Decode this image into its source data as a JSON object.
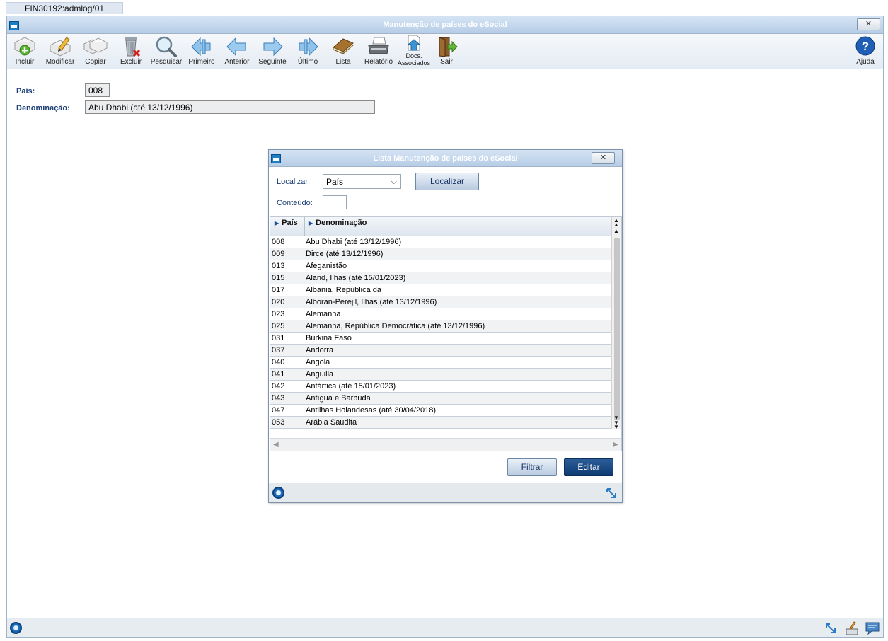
{
  "app": {
    "tab_label": "FIN30192:admlog/01",
    "window_title": "Manutenção de países do eSocial"
  },
  "toolbar": {
    "buttons": [
      {
        "label": "Incluir",
        "icon": "add-doc-icon"
      },
      {
        "label": "Modificar",
        "icon": "edit-doc-icon"
      },
      {
        "label": "Copiar",
        "icon": "copy-doc-icon"
      },
      {
        "label": "Excluir",
        "icon": "trash-icon"
      },
      {
        "label": "Pesquisar",
        "icon": "search-icon"
      },
      {
        "label": "Primeiro",
        "icon": "first-arrow-icon"
      },
      {
        "label": "Anterior",
        "icon": "prev-arrow-icon"
      },
      {
        "label": "Seguinte",
        "icon": "next-arrow-icon"
      },
      {
        "label": "Último",
        "icon": "last-arrow-icon"
      },
      {
        "label": "Lista",
        "icon": "book-icon"
      },
      {
        "label": "Relatório",
        "icon": "printer-icon"
      },
      {
        "label": "Docs. Associados",
        "icon": "upload-doc-icon"
      },
      {
        "label": "Sair",
        "icon": "exit-door-icon"
      }
    ],
    "help_label": "Ajuda",
    "help_icon": "help-icon"
  },
  "form": {
    "pais_label": "País:",
    "pais_value": "008",
    "denominacao_label": "Denominação:",
    "denominacao_value": "Abu Dhabi (até 13/12/1996)"
  },
  "dialog": {
    "title": "Lista Manutenção de países do eSocial",
    "localizar_label": "Localizar:",
    "localizar_selected": "País",
    "localizar_button": "Localizar",
    "conteudo_label": "Conteúdo:",
    "conteudo_value": "",
    "grid": {
      "columns": [
        "País",
        "Denominação"
      ],
      "rows": [
        [
          "008",
          "Abu Dhabi (até 13/12/1996)"
        ],
        [
          "009",
          "Dirce (até 13/12/1996)"
        ],
        [
          "013",
          "Afeganistão"
        ],
        [
          "015",
          "Aland, Ilhas (até 15/01/2023)"
        ],
        [
          "017",
          "Albania, República da"
        ],
        [
          "020",
          "Alboran-Perejil, Ilhas (até 13/12/1996)"
        ],
        [
          "023",
          "Alemanha"
        ],
        [
          "025",
          "Alemanha, República Democrática (até 13/12/1996)"
        ],
        [
          "031",
          "Burkina Faso"
        ],
        [
          "037",
          "Andorra"
        ],
        [
          "040",
          "Angola"
        ],
        [
          "041",
          "Anguilla"
        ],
        [
          "042",
          "Antártica (até 15/01/2023)"
        ],
        [
          "043",
          "Antígua e Barbuda"
        ],
        [
          "047",
          "Antilhas Holandesas (até 30/04/2018)"
        ],
        [
          "053",
          "Arábia Saudita"
        ]
      ]
    },
    "filtrar_button": "Filtrar",
    "editar_button": "Editar"
  },
  "colors": {
    "title_bar": "#b6cde6",
    "label_blue": "#1d3f77",
    "primary_button": "#0e3a72"
  }
}
